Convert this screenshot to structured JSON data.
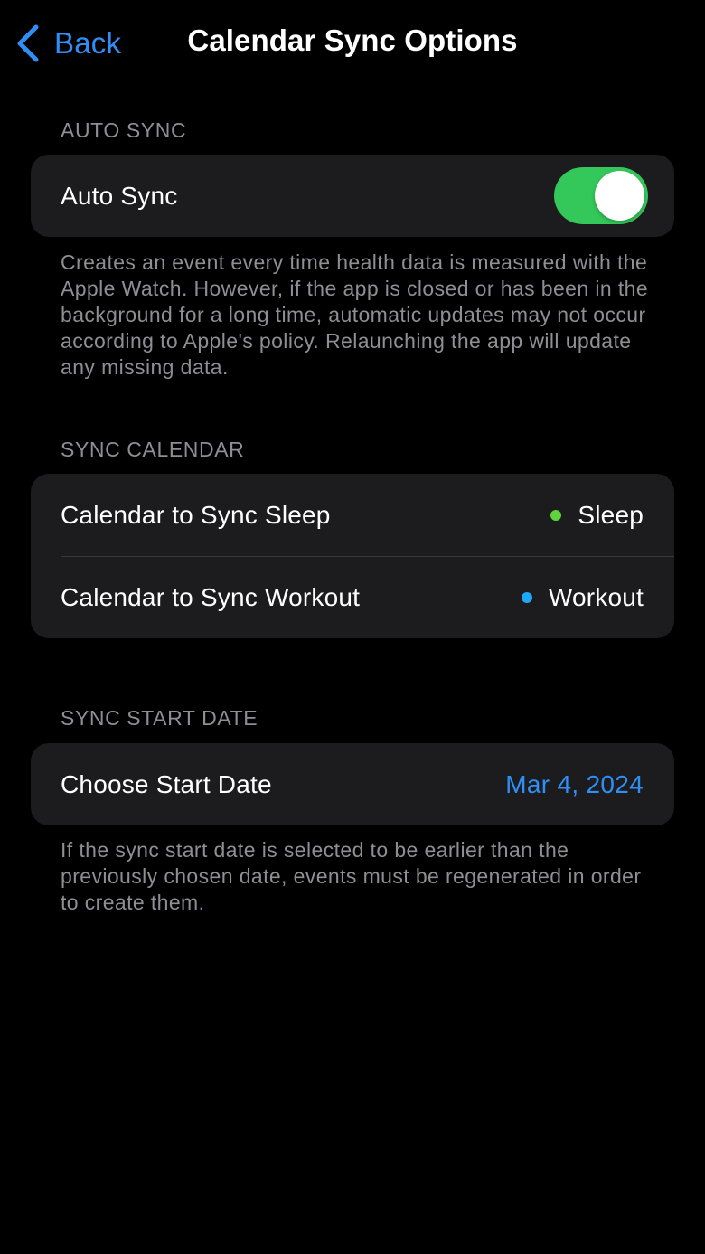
{
  "nav": {
    "back_label": "Back",
    "title": "Calendar Sync Options"
  },
  "auto_sync": {
    "header": "AUTO SYNC",
    "label": "Auto Sync",
    "enabled": true,
    "footnote": "Creates an event every time health data is measured with the Apple Watch. However, if the app is closed or has been in the background for a long time, automatic updates may not occur according to Apple's policy. Relaunching the app will update any missing data."
  },
  "sync_calendar": {
    "header": "SYNC CALENDAR",
    "rows": [
      {
        "label": "Calendar to Sync Sleep",
        "value": "Sleep",
        "dot_color": "#5fd33a"
      },
      {
        "label": "Calendar to Sync Workout",
        "value": "Workout",
        "dot_color": "#1ea8f5"
      }
    ]
  },
  "sync_start_date": {
    "header": "SYNC START DATE",
    "label": "Choose Start Date",
    "value": "Mar 4, 2024",
    "footnote": "If the sync start date is selected to be earlier than the previously chosen date, events must be regenerated in order to create them."
  },
  "colors": {
    "accent": "#2f8ff6",
    "toggle_on": "#34c759"
  }
}
